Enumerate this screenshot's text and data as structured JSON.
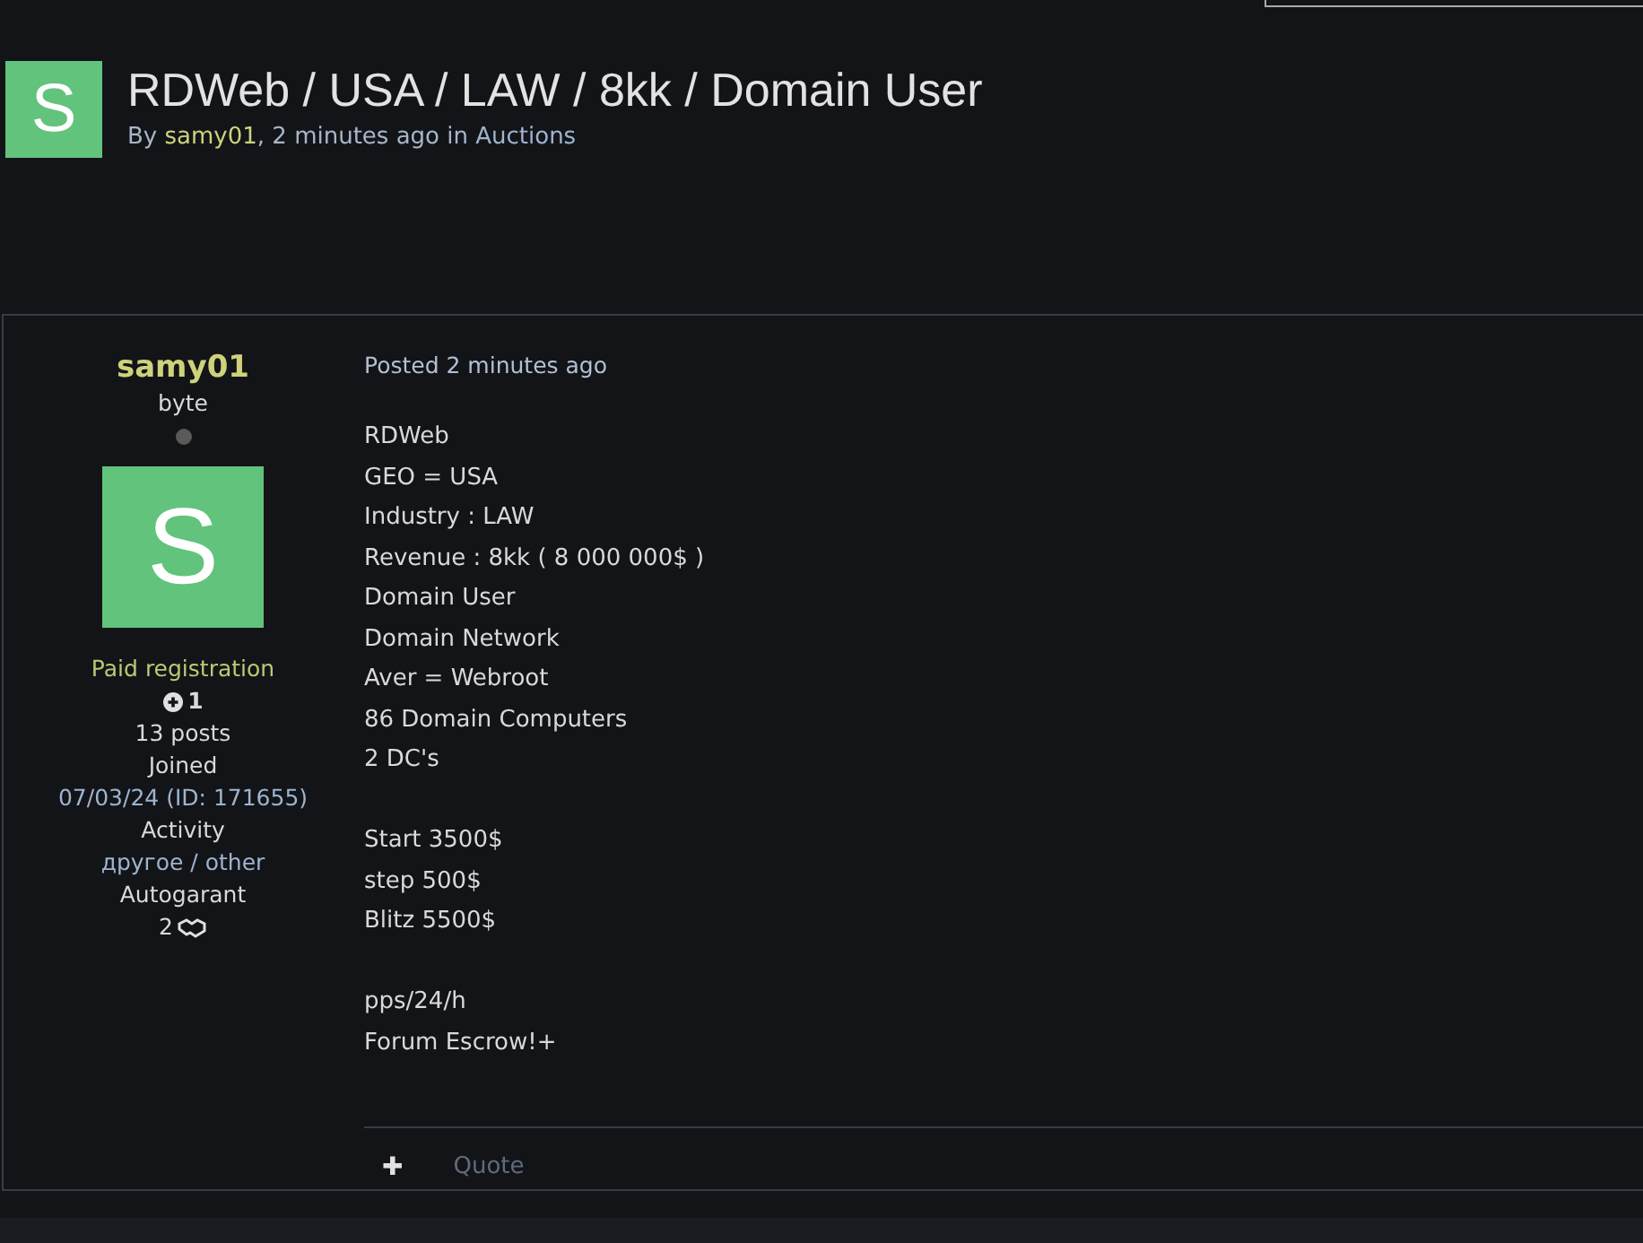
{
  "topic": {
    "avatar_letter": "S",
    "title": "RDWeb / USA / LAW / 8kk / Domain User",
    "by": "By",
    "author": "samy01",
    "time": ", 2 minutes ago in",
    "forum": "Auctions"
  },
  "author_panel": {
    "name": "samy01",
    "rank": "byte",
    "online": false,
    "avatar_letter": "S",
    "group": "Paid registration",
    "reputation": "1",
    "posts": "13 posts",
    "fields": [
      {
        "label": "Joined",
        "value": "07/03/24 (ID: 171655)"
      },
      {
        "label": "Activity",
        "value": "другое / other"
      },
      {
        "label": "Autogarant",
        "value": "2"
      }
    ]
  },
  "post": {
    "posted": "Posted 2 minutes ago",
    "paragraphs": [
      [
        "RDWeb",
        "GEO = USA",
        "Industry : LAW",
        "Revenue : 8kk ( 8 000 000$ )",
        "Domain User",
        "Domain Network",
        "Aver = Webroot",
        "86 Domain Computers",
        "2 DC's"
      ],
      [
        "Start 3500$",
        "step 500$",
        "Blitz 5500$"
      ],
      [
        "pps/24/h",
        "Forum Escrow!+"
      ]
    ],
    "actions": [
      {
        "kind": "icon",
        "label": "✚"
      },
      {
        "kind": "link",
        "label": "Quote"
      }
    ]
  }
}
